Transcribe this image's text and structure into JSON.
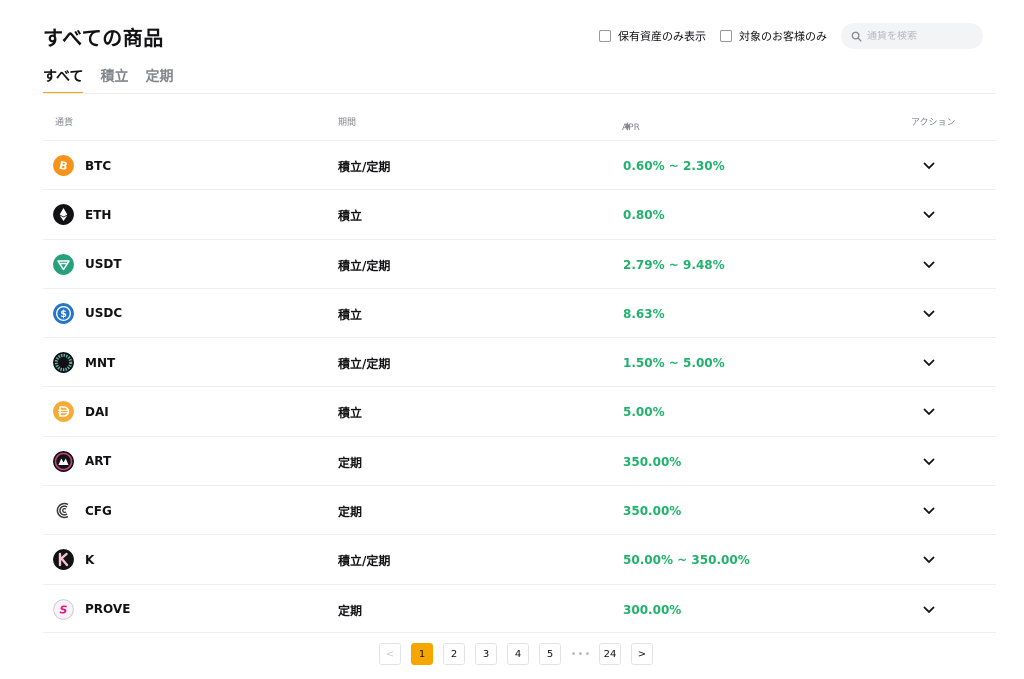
{
  "header": {
    "title": "すべての商品"
  },
  "filters": {
    "own_assets_label": "保有資産のみ表示",
    "eligible_only_label": "対象のお客様のみ",
    "search_placeholder": "通貨を検索"
  },
  "tabs": [
    {
      "label": "すべて",
      "active": true
    },
    {
      "label": "積立",
      "active": false
    },
    {
      "label": "定期",
      "active": false
    }
  ],
  "table": {
    "columns": {
      "coin": "通貨",
      "term": "期間",
      "apr": "APR",
      "action": "アクション"
    },
    "rows": [
      {
        "coin": "BTC",
        "icon": "bitcoin-icon",
        "icon_color": "#f7931a",
        "term": "積立/定期",
        "apr": "0.60% ~ 2.30%"
      },
      {
        "coin": "ETH",
        "icon": "ethereum-icon",
        "icon_color": "#121214",
        "term": "積立",
        "apr": "0.80%"
      },
      {
        "coin": "USDT",
        "icon": "tether-icon",
        "icon_color": "#26a17b",
        "term": "積立/定期",
        "apr": "2.79% ~ 9.48%"
      },
      {
        "coin": "USDC",
        "icon": "usdc-icon",
        "icon_color": "#2775ca",
        "term": "積立",
        "apr": "8.63%"
      },
      {
        "coin": "MNT",
        "icon": "mantle-icon",
        "icon_color": "#121214",
        "term": "積立/定期",
        "apr": "1.50% ~ 5.00%"
      },
      {
        "coin": "DAI",
        "icon": "dai-icon",
        "icon_color": "#f5ac37",
        "term": "積立",
        "apr": "5.00%"
      },
      {
        "coin": "ART",
        "icon": "art-icon",
        "icon_color": "#121214",
        "term": "定期",
        "apr": "350.00%"
      },
      {
        "coin": "CFG",
        "icon": "centrifuge-icon",
        "icon_color": "#2a2a2a",
        "term": "定期",
        "apr": "350.00%"
      },
      {
        "coin": "K",
        "icon": "k-icon",
        "icon_color": "#121214",
        "term": "積立/定期",
        "apr": "50.00% ~ 350.00%"
      },
      {
        "coin": "PROVE",
        "icon": "prove-icon",
        "icon_color": "#e0137f",
        "term": "定期",
        "apr": "300.00%"
      }
    ]
  },
  "pagination": {
    "prev": "<",
    "pages": [
      "1",
      "2",
      "3",
      "4",
      "5"
    ],
    "ellipsis": "•••",
    "last": "24",
    "next": ">",
    "current": "1"
  },
  "colors": {
    "accent": "#f7a600",
    "positive": "#20b26c",
    "text": "#121214",
    "muted": "#81858c"
  }
}
